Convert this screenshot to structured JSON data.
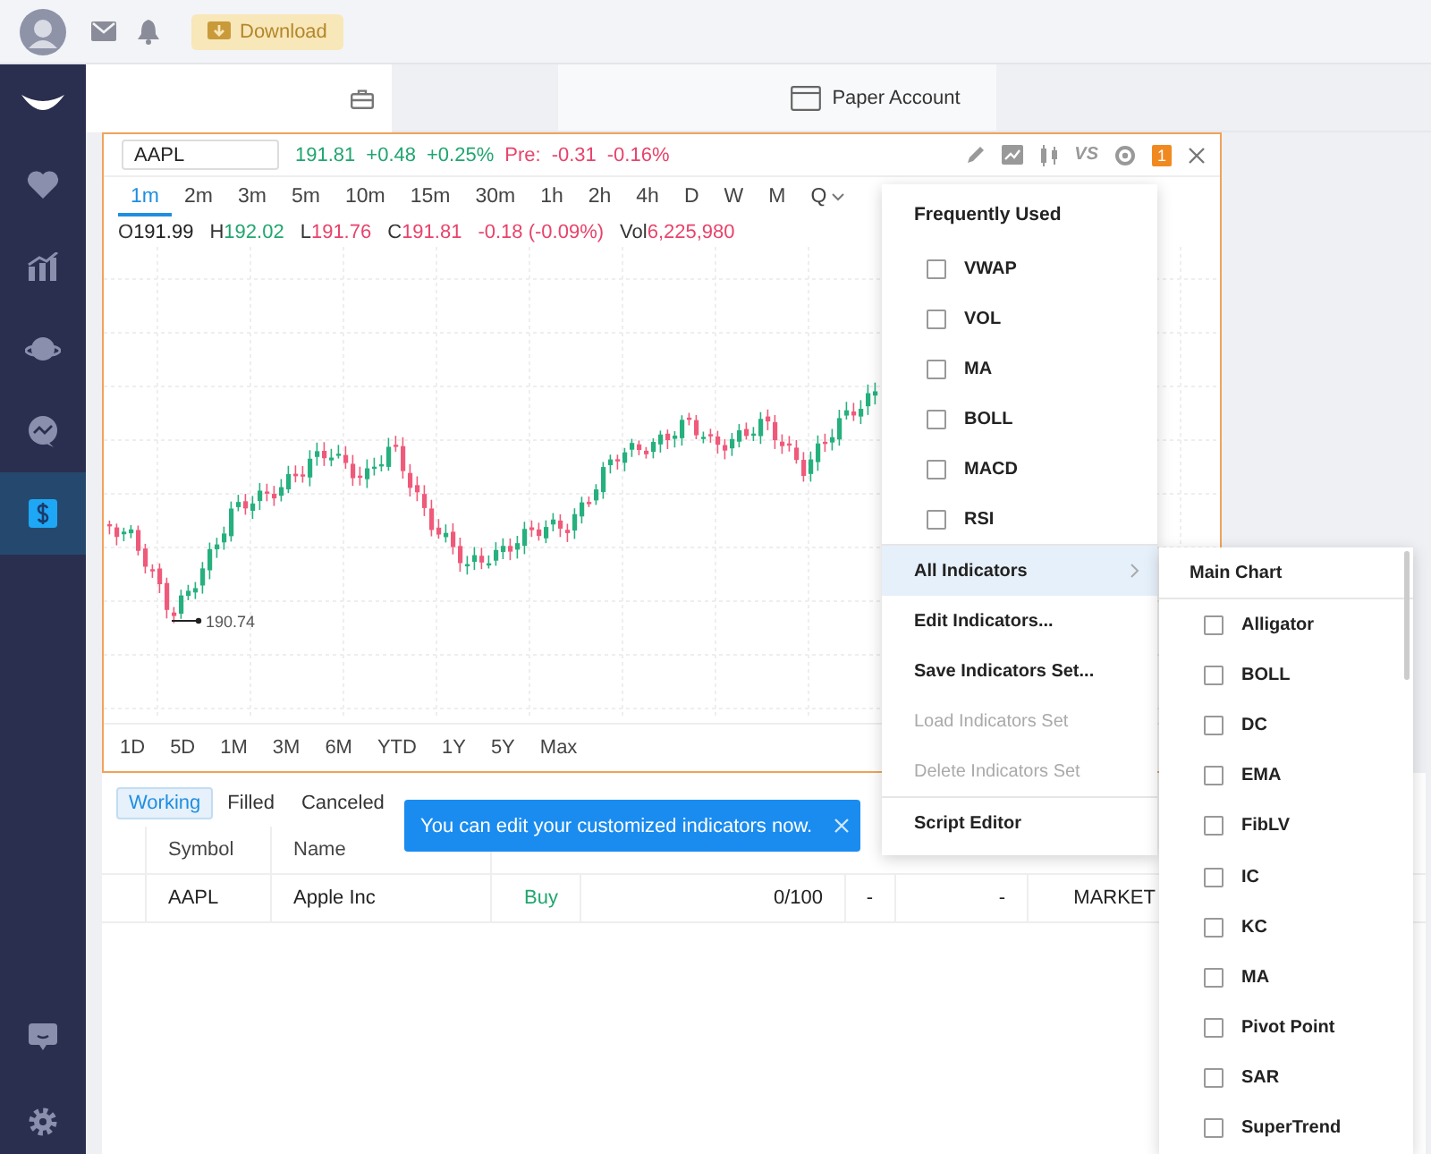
{
  "topbar": {
    "download_button": "Download"
  },
  "sidebar": {
    "items": [
      {
        "selected": false
      },
      {
        "selected": false
      },
      {
        "selected": false
      },
      {
        "selected": false
      },
      {
        "selected": true
      }
    ]
  },
  "account_tabs": [
    {
      "label": "Paper Account"
    }
  ],
  "chart_panel": {
    "symbol": "AAPL",
    "quote": [
      {
        "text": "191.81",
        "color": "#21a670"
      },
      {
        "text": "+0.48",
        "color": "#21a670"
      },
      {
        "text": "+0.25%",
        "color": "#21a670"
      },
      {
        "text": "Pre:",
        "color": "#e8436a"
      },
      {
        "text": "-0.31",
        "color": "#e8436a"
      },
      {
        "text": "-0.16%",
        "color": "#e8436a"
      }
    ],
    "tools": {
      "compare": "VS",
      "badge": "1"
    },
    "intervals": [
      {
        "label": "1m",
        "selected": true
      },
      {
        "label": "2m",
        "selected": false
      },
      {
        "label": "3m",
        "selected": false
      },
      {
        "label": "5m",
        "selected": false
      },
      {
        "label": "10m",
        "selected": false
      },
      {
        "label": "15m",
        "selected": false
      },
      {
        "label": "30m",
        "selected": false
      },
      {
        "label": "1h",
        "selected": false
      },
      {
        "label": "2h",
        "selected": false
      },
      {
        "label": "4h",
        "selected": false
      },
      {
        "label": "D",
        "selected": false
      },
      {
        "label": "W",
        "selected": false
      },
      {
        "label": "M",
        "selected": false
      },
      {
        "label": "Q",
        "selected": false
      }
    ],
    "ohlc": [
      {
        "label": "O",
        "value": "191.99",
        "color": "#222222"
      },
      {
        "label": "H",
        "value": "192.02",
        "color": "#21a670"
      },
      {
        "label": "L",
        "value": "191.76",
        "color": "#e8436a"
      },
      {
        "label": "C",
        "value": "191.81",
        "color": "#e8436a"
      },
      {
        "value": "-0.18 (-0.09%)",
        "color": "#e8436a"
      },
      {
        "label": "Vol",
        "value": "6,225,980",
        "color": "#e8436a"
      }
    ],
    "low_label": "190.74",
    "ranges": [
      "1D",
      "5D",
      "1M",
      "3M",
      "6M",
      "YTD",
      "1Y",
      "5Y",
      "Max"
    ]
  },
  "orders": {
    "tabs": [
      {
        "label": "Working",
        "selected": true
      },
      {
        "label": "Filled",
        "selected": false
      },
      {
        "label": "Canceled",
        "selected": false
      }
    ],
    "columns": [
      "Symbol",
      "Name"
    ],
    "rows": [
      {
        "cells": [
          {
            "text": "AAPL",
            "color": "#222222"
          },
          {
            "text": "Apple Inc",
            "color": "#222222"
          },
          {
            "text": "Buy",
            "color": "#21a670"
          },
          {
            "text": "0/100",
            "color": "#222222"
          },
          {
            "text": "-",
            "color": "#222222"
          },
          {
            "text": "-",
            "color": "#222222"
          },
          {
            "text": "MARKET",
            "color": "#222222"
          }
        ]
      }
    ]
  },
  "tooltip": {
    "text": "You can edit your customized indicators now."
  },
  "indicator_menu": {
    "title": "Frequently Used",
    "frequent": [
      {
        "label": "VWAP",
        "checked": false
      },
      {
        "label": "VOL",
        "checked": false
      },
      {
        "label": "MA",
        "checked": false
      },
      {
        "label": "BOLL",
        "checked": false
      },
      {
        "label": "MACD",
        "checked": false
      },
      {
        "label": "RSI",
        "checked": false
      }
    ],
    "actions": [
      {
        "label": "All Indicators",
        "kind": "submenu",
        "selected": true,
        "disabled": false
      },
      {
        "label": "Edit Indicators...",
        "kind": "action",
        "selected": false,
        "disabled": false
      },
      {
        "label": "Save Indicators Set...",
        "kind": "action",
        "selected": false,
        "disabled": false
      },
      {
        "label": "Load Indicators Set",
        "kind": "action",
        "selected": false,
        "disabled": true
      },
      {
        "label": "Delete Indicators Set",
        "kind": "action",
        "selected": false,
        "disabled": true
      }
    ],
    "footer_actions": [
      {
        "label": "Script Editor",
        "disabled": false
      }
    ]
  },
  "submenu": {
    "title": "Main Chart",
    "items": [
      {
        "label": "Alligator",
        "checked": false
      },
      {
        "label": "BOLL",
        "checked": false
      },
      {
        "label": "DC",
        "checked": false
      },
      {
        "label": "EMA",
        "checked": false
      },
      {
        "label": "FibLV",
        "checked": false
      },
      {
        "label": "IC",
        "checked": false
      },
      {
        "label": "KC",
        "checked": false
      },
      {
        "label": "MA",
        "checked": false
      },
      {
        "label": "Pivot Point",
        "checked": false
      },
      {
        "label": "SAR",
        "checked": false
      },
      {
        "label": "SuperTrend",
        "checked": false
      }
    ]
  }
}
